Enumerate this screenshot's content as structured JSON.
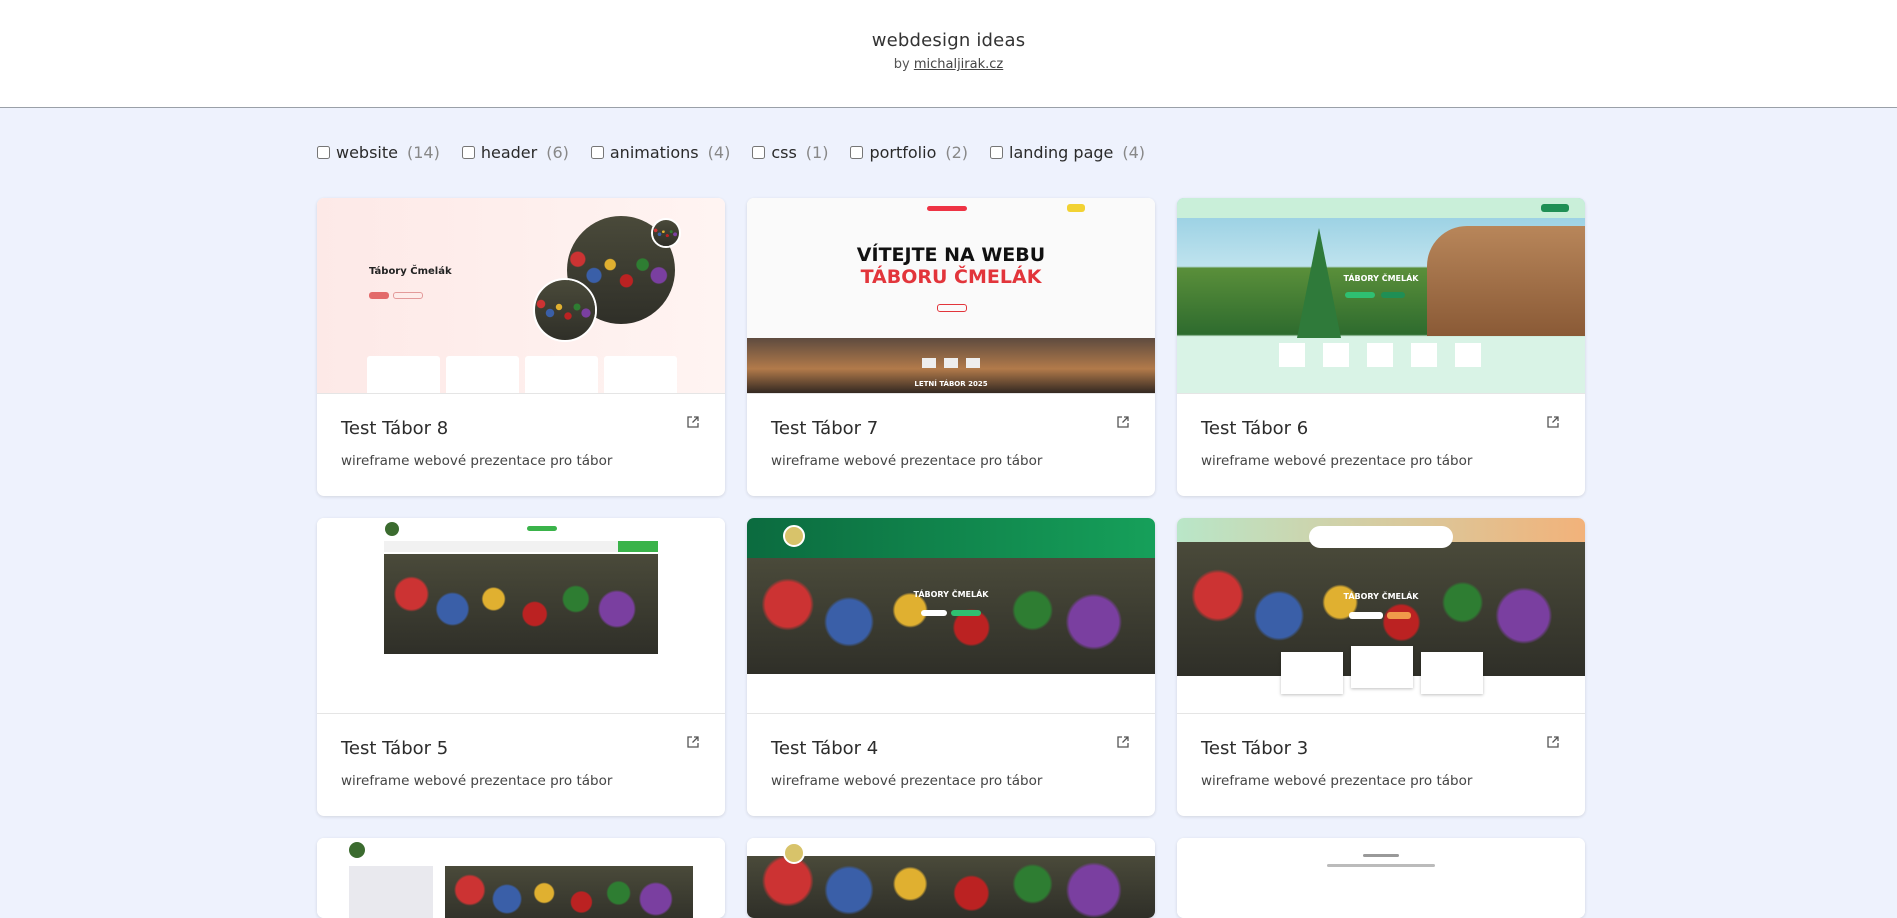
{
  "header": {
    "title": "webdesign ideas",
    "by": "by",
    "author_link": "michaljirak.cz"
  },
  "filters": [
    {
      "label": "website",
      "count": "(14)"
    },
    {
      "label": "header",
      "count": "(6)"
    },
    {
      "label": "animations",
      "count": "(4)"
    },
    {
      "label": "css",
      "count": "(1)"
    },
    {
      "label": "portfolio",
      "count": "(2)"
    },
    {
      "label": "landing page",
      "count": "(4)"
    }
  ],
  "cards": [
    {
      "title": "Test Tábor 8",
      "desc": "wireframe webové prezentace pro tábor",
      "thumb_title": "Tábory Čmelák"
    },
    {
      "title": "Test Tábor 7",
      "desc": "wireframe webové prezentace pro tábor",
      "thumb_title_1": "VÍTEJTE NA WEBU",
      "thumb_title_2": "TÁBORU ČMELÁK",
      "thumb_caption": "LETNÍ TÁBOR 2025"
    },
    {
      "title": "Test Tábor 6",
      "desc": "wireframe webové prezentace pro tábor",
      "thumb_title": "TÁBORY ČMELÁK"
    },
    {
      "title": "Test Tábor 5",
      "desc": "wireframe webové prezentace pro tábor"
    },
    {
      "title": "Test Tábor 4",
      "desc": "wireframe webové prezentace pro tábor",
      "thumb_title": "TÁBORY ČMELÁK"
    },
    {
      "title": "Test Tábor 3",
      "desc": "wireframe webové prezentace pro tábor",
      "thumb_title": "TÁBORY ČMELÁK"
    }
  ],
  "icons": {
    "external": "external-link-icon"
  }
}
